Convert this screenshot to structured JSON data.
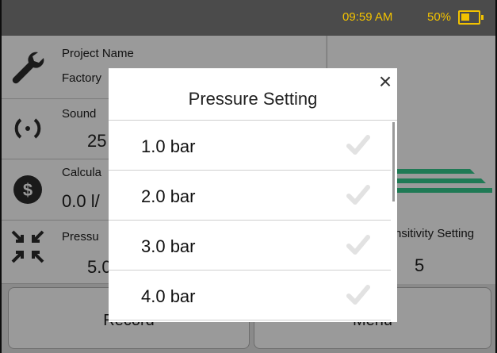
{
  "status": {
    "time": "09:59 AM",
    "battery_percent": "50%",
    "battery_level": 0.5,
    "accent_color": "#f2c200"
  },
  "rows": [
    {
      "label": "Project Name",
      "value": "Factory",
      "icon": "wrench-icon"
    },
    {
      "label": "Sound",
      "value": "25",
      "icon": "sound-waves-icon"
    },
    {
      "label": "Calcula",
      "value": "0.0 l/",
      "icon": "dollar-icon"
    },
    {
      "label": "Pressu",
      "value": "5.0",
      "icon": "pressure-arrows-icon"
    }
  ],
  "right_panel": {
    "logo": "company-logo-stripes"
  },
  "sensitivity": {
    "label": "nsitivity Setting",
    "value": "5"
  },
  "bottom_buttons": {
    "record": "Record",
    "menu": "Menu"
  },
  "modal": {
    "title": "Pressure Setting",
    "close_icon": "close-icon",
    "options": [
      {
        "label": "1.0 bar"
      },
      {
        "label": "2.0 bar"
      },
      {
        "label": "3.0 bar"
      },
      {
        "label": "4.0 bar"
      }
    ]
  }
}
